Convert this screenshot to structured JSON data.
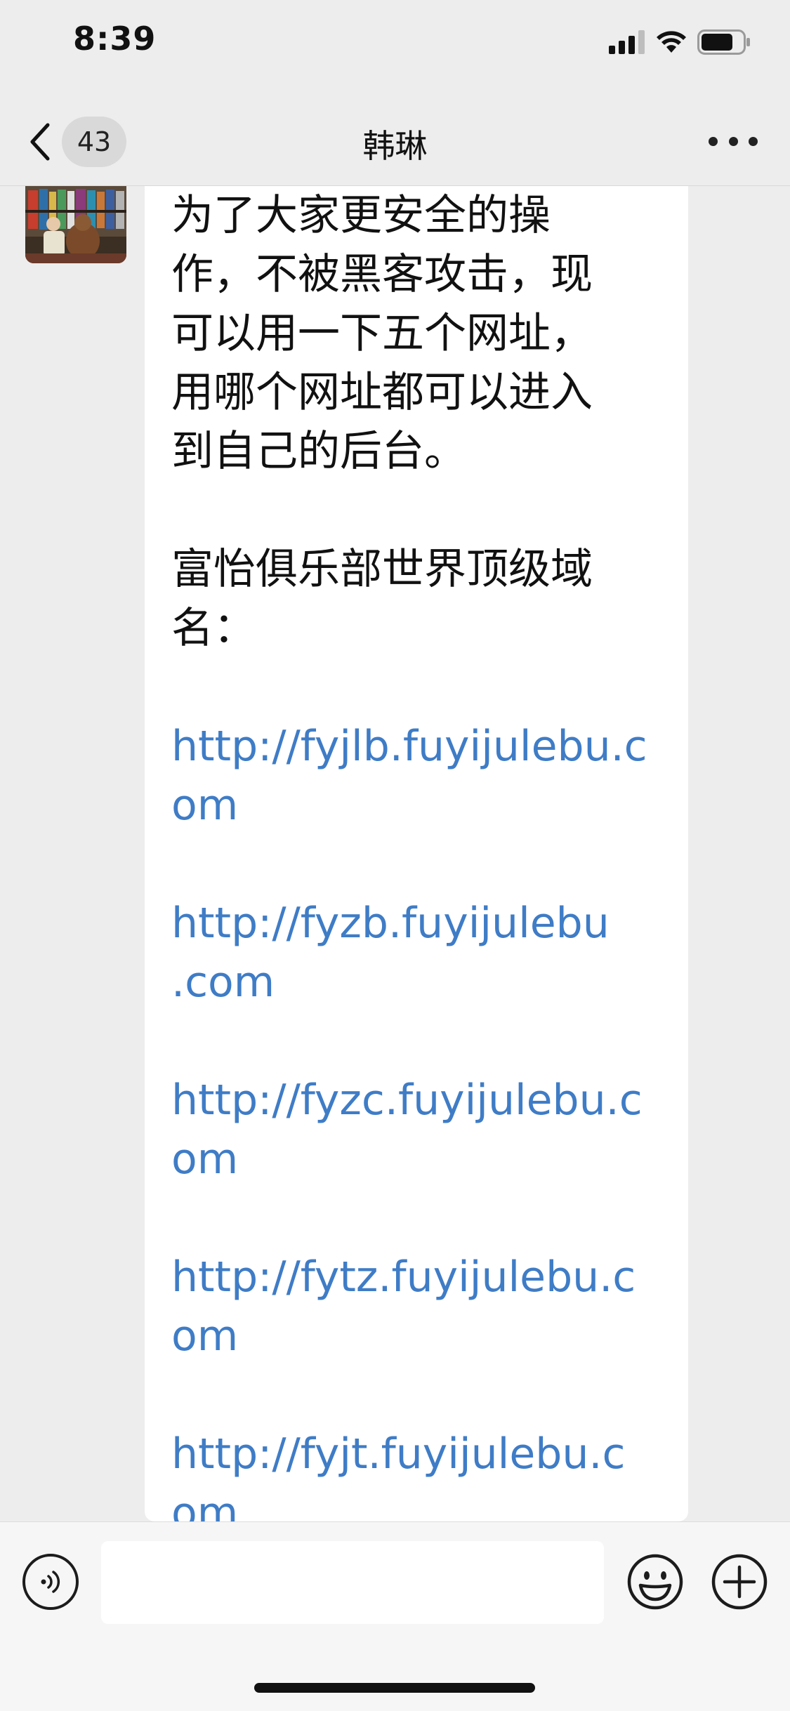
{
  "status_bar": {
    "time": "8:39",
    "icons": [
      "cellular-signal-icon",
      "wifi-icon",
      "battery-icon"
    ]
  },
  "nav": {
    "back_icon": "chevron-left-icon",
    "unread_count": "43",
    "title": "韩琳",
    "more_icon": "more-dots-icon"
  },
  "message": {
    "sender_avatar": "avatar-photo",
    "intro_lines": [
      "为了大家更安全的操",
      "作，不被黑客攻击，现",
      "可以用一下五个网址，",
      "用哪个网址都可以进入",
      "到自己的后台。"
    ],
    "heading_lines": [
      "富怡俱乐部世界顶级域",
      "名："
    ],
    "links": [
      {
        "line1": "http://fyjlb.fuyijulebu.c",
        "line2": "om"
      },
      {
        "line1": "http://fyzb.fuyijulebu",
        "line2": ".com"
      },
      {
        "line1": "http://fyzc.fuyijulebu.c",
        "line2": "om"
      },
      {
        "line1": "http://fytz.fuyijulebu.c",
        "line2": "om"
      },
      {
        "line1": "http://fyjt.fuyijulebu.c",
        "line2": "om"
      }
    ]
  },
  "input_bar": {
    "voice_icon": "voice-input-icon",
    "text_value": "",
    "emoji_icon": "emoji-icon",
    "plus_icon": "plus-circle-icon"
  },
  "colors": {
    "link": "#3f7cc6",
    "background": "#ededed",
    "bubble": "#ffffff"
  }
}
